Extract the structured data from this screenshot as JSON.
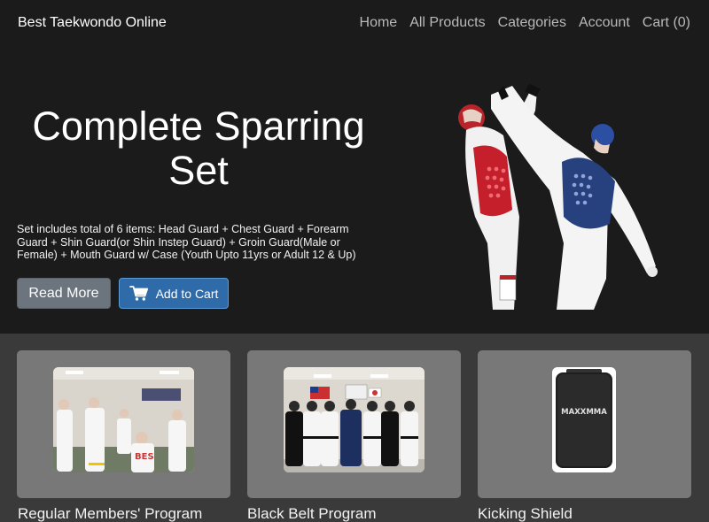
{
  "navbar": {
    "brand": "Best Taekwondo Online",
    "links": [
      "Home",
      "All Products",
      "Categories",
      "Account",
      "Cart (0)"
    ]
  },
  "hero": {
    "title_line1": "Complete Sparring",
    "title_line2": "Set",
    "description": "Set includes total of 6 items: Head Guard + Chest Guard + Forearm Guard + Shin Guard(or Shin Instep Guard) + Groin Guard(Male or Female) + Mouth Guard w/ Case (Youth Upto 11yrs or Adult 12 & Up)",
    "read_more_label": "Read More",
    "add_to_cart_label": "Add to Cart",
    "image_icon": "sparring-athletes-photo"
  },
  "products": [
    {
      "title": "Regular Members' Program",
      "image_icon": "class-group-photo"
    },
    {
      "title": "Black Belt Program",
      "image_icon": "black-belt-group-photo"
    },
    {
      "title": "Kicking Shield",
      "image_icon": "kicking-shield-photo",
      "logo_text": "MAXXMMA"
    }
  ],
  "colors": {
    "background": "#1b1b1b",
    "products_band": "#3a3a3a",
    "card": "#787878",
    "primary_button": "#2f6ba9",
    "secondary_button": "#6c757d"
  }
}
